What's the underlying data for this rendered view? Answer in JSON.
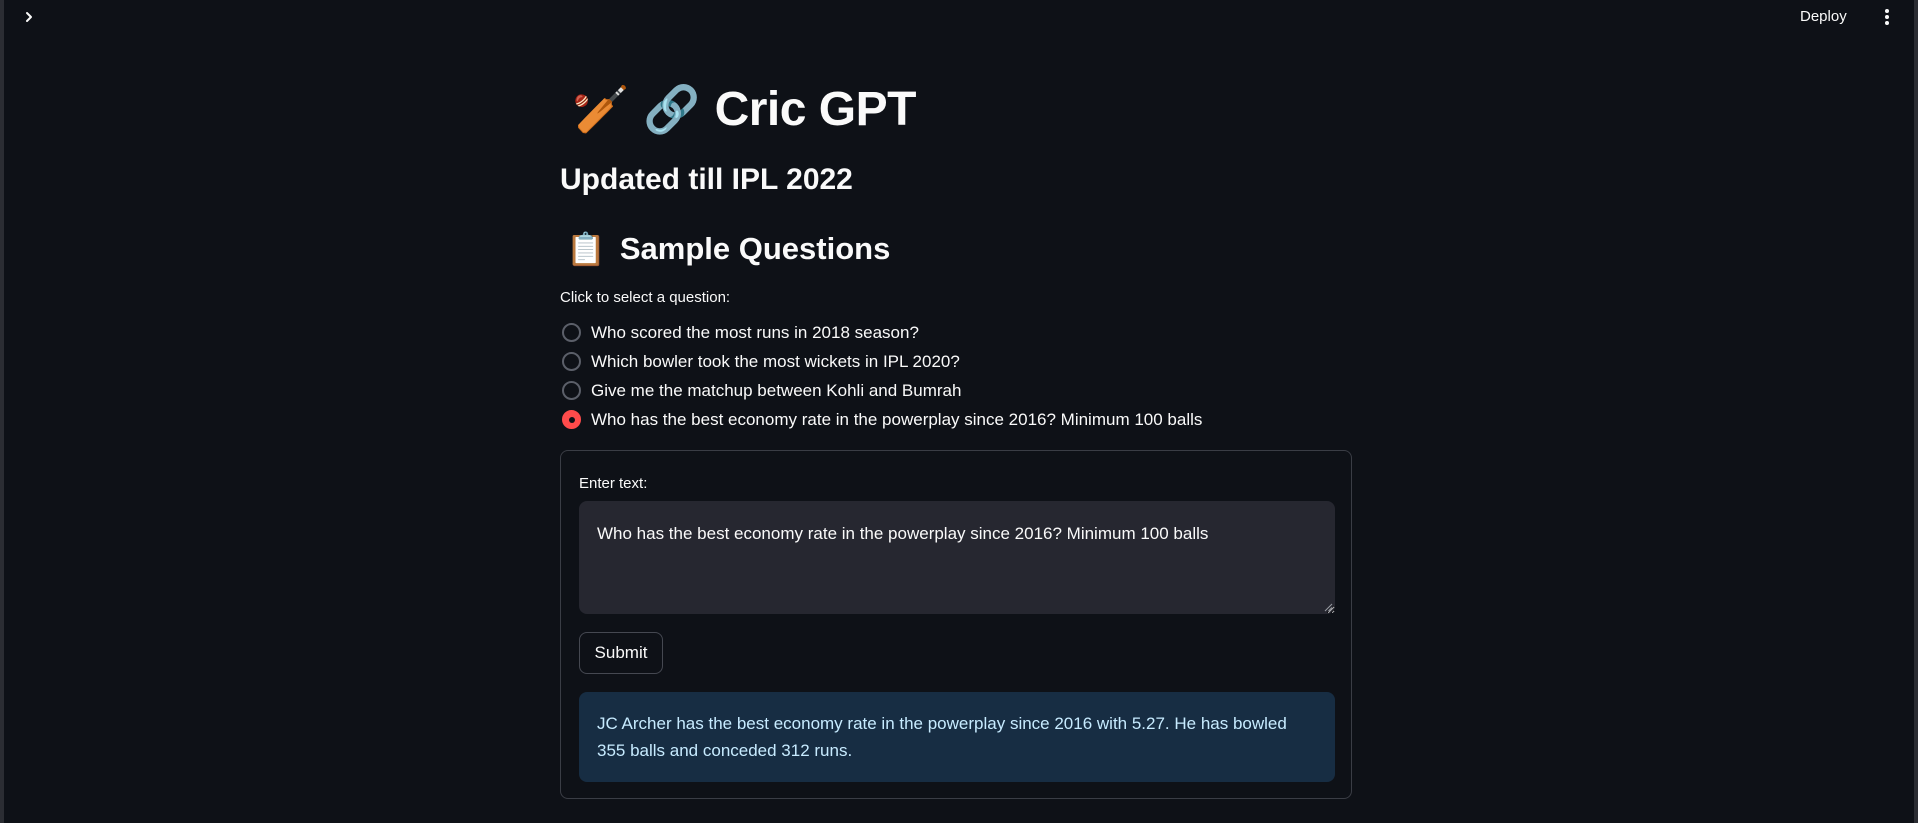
{
  "header": {
    "deploy_label": "Deploy",
    "expand_icon": "chevron-right-icon",
    "menu_icon": "vertical-dots-icon"
  },
  "main": {
    "title_emoji_1": "🏏",
    "title_emoji_2": "🔗",
    "title": "Cric GPT",
    "subtitle": "Updated till IPL 2022",
    "sample_emoji": "📋",
    "sample_title": "Sample Questions",
    "radio_label": "Click to select a question:",
    "questions": [
      {
        "text": "Who scored the most runs in 2018 season?",
        "selected": false
      },
      {
        "text": "Which bowler took the most wickets in IPL 2020?",
        "selected": false
      },
      {
        "text": "Give me the matchup between Kohli and Bumrah",
        "selected": false
      },
      {
        "text": "Who has the best economy rate in the powerplay since 2016? Minimum 100 balls",
        "selected": true
      }
    ]
  },
  "form": {
    "text_label": "Enter text:",
    "text_value": "Who has the best economy rate in the powerplay since 2016? Minimum 100 balls",
    "submit_label": "Submit",
    "result": "JC Archer has the best economy rate in the powerplay since 2016 with 5.27. He has bowled 355 balls and conceded 312 runs."
  },
  "colors": {
    "background": "#0e1117",
    "accent": "#ff4b4b",
    "input_bg": "#262730",
    "info_bg": "#172d43",
    "info_text": "#c7ebff"
  }
}
